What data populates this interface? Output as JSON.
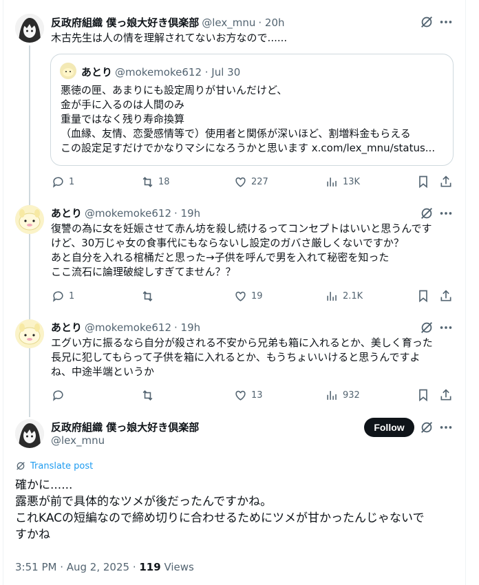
{
  "tweets": [
    {
      "name": "反政府組織 僕っ娘大好き倶楽部",
      "handle": "@lex_mnu",
      "time": "· 20h",
      "text": "木古先生は人の情を理解されてないお方なので......",
      "quote": {
        "name": "あとり",
        "handle": "@mokemoke612 · Jul 30",
        "lines": [
          "悪徳の匣、あまりにも設定周りが甘いんだけど、",
          "金が手に入るのは人間のみ",
          "重量ではなく残り寿命換算",
          "（血縁、友情、恋愛感情等で）使用者と関係が深いほど、割増料金もらえる",
          "この設定足すだけでかなりマシになろうかと思います x.com/lex_mnu/status..."
        ]
      },
      "stats": {
        "replies": "1",
        "reposts": "18",
        "likes": "227",
        "views": "13K"
      }
    },
    {
      "name": "あとり",
      "handle": "@mokemoke612",
      "time": "· 19h",
      "lines": [
        "復讐の為に女を妊娠させて赤ん坊を殺し続けるってコンセプトはいいと思うんです",
        "けど、30万じゃ女の食事代にもならないし設定のガバさ厳しくないですか？",
        "あと自分を入れる棺桶だと思った→子供を呼んで男を入れて秘密を知った",
        "ここ流石に論理破綻しすぎてません？？"
      ],
      "stats": {
        "replies": "1",
        "reposts": "",
        "likes": "19",
        "views": "2.1K"
      }
    },
    {
      "name": "あとり",
      "handle": "@mokemoke612",
      "time": "· 19h",
      "lines": [
        "エグい方に振るなら自分が殺される不安から兄弟も箱に入れるとか、美しく育った",
        "長兄に犯してもらって子供を箱に入れるとか、もうちょいいけると思うんですよ",
        "ね、中途半端というか"
      ],
      "stats": {
        "replies": "",
        "reposts": "",
        "likes": "13",
        "views": "932"
      }
    }
  ],
  "main": {
    "name": "反政府組織 僕っ娘大好き倶楽部",
    "handle": "@lex_mnu",
    "follow_label": "Follow",
    "translate_label": "Translate post",
    "lines": [
      "確かに......",
      "露悪が前で具体的なツメが後だったんですかね。",
      "これKACの短編なので締め切りに合わせるためにツメが甘かったんじゃないで",
      "すかね"
    ],
    "timestamp": "3:51 PM · Aug 2, 2025 · ",
    "views_count": "119",
    "views_label": " Views"
  },
  "icons": [
    "grok-icon",
    "more-icon",
    "reply-icon",
    "repost-icon",
    "like-icon",
    "views-icon",
    "bookmark-icon",
    "share-icon",
    "globe-icon"
  ],
  "colors": {
    "text": "#0f1419",
    "muted": "#536471",
    "border": "#cfd9de",
    "link": "#1d9bf0"
  }
}
